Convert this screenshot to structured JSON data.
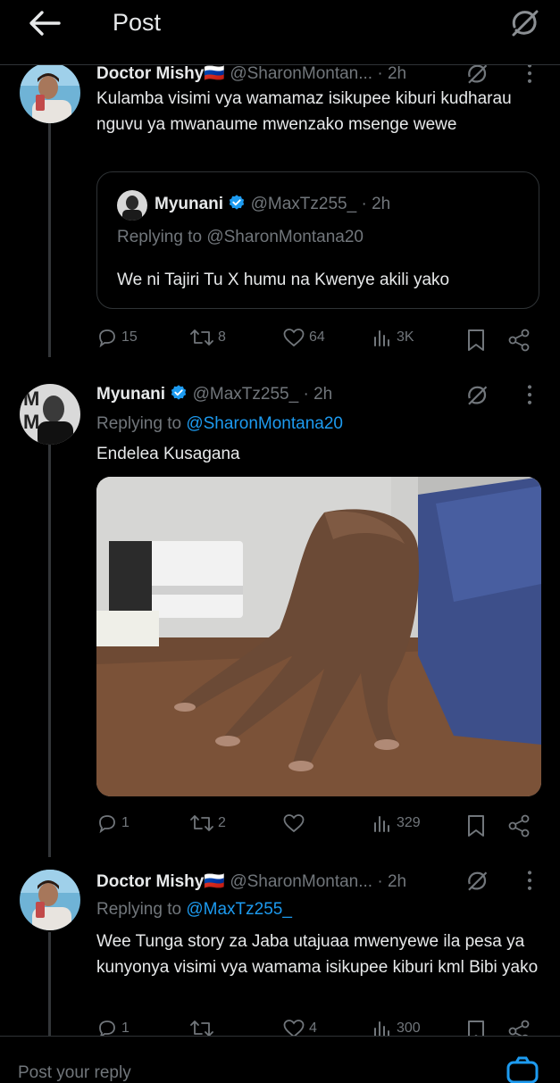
{
  "header": {
    "title": "Post",
    "back_icon": "arrow-left-icon",
    "grok_icon": "grok-icon"
  },
  "tweets": [
    {
      "author": "Doctor Mishy",
      "flag": "🇷🇺",
      "handle": "@SharonMontan...",
      "time": "· 2h",
      "text": "Kulamba visimi vya wamamaz isikupee kiburi kudharau nguvu ya mwanaume mwenzako msenge wewe",
      "quote": {
        "author": "Myunani",
        "handle": "@MaxTz255_",
        "time": "· 2h",
        "replying_prefix": "Replying to ",
        "replying_to": "@SharonMontana20",
        "text": "We ni Tajiri Tu X humu na Kwenye akili yako"
      },
      "replies": "15",
      "reposts": "8",
      "likes": "64",
      "views": "3K"
    },
    {
      "author": "Myunani",
      "handle": "@MaxTz255_",
      "time": "· 2h",
      "replying_prefix": "Replying to ",
      "replying_to": "@SharonMontana20",
      "text": "Endelea Kusagana",
      "replies": "1",
      "reposts": "2",
      "likes": "",
      "views": "329"
    },
    {
      "author": "Doctor Mishy",
      "flag": "🇷🇺",
      "handle": "@SharonMontan...",
      "time": "· 2h",
      "replying_prefix": "Replying to ",
      "replying_to": "@MaxTz255_",
      "text": "Wee Tunga story za Jaba utajuaa mwenyewe ila pesa ya kunyonya visimi vya wamama isikupee kiburi kml Bibi yako",
      "replies": "1",
      "reposts": "",
      "likes": "4",
      "views": "300"
    }
  ],
  "compose": {
    "placeholder": "Post your reply"
  },
  "colors": {
    "background": "#000000",
    "text": "#e7e9ea",
    "muted": "#71767b",
    "accent": "#1d9bf0",
    "divider": "#2f3336"
  }
}
